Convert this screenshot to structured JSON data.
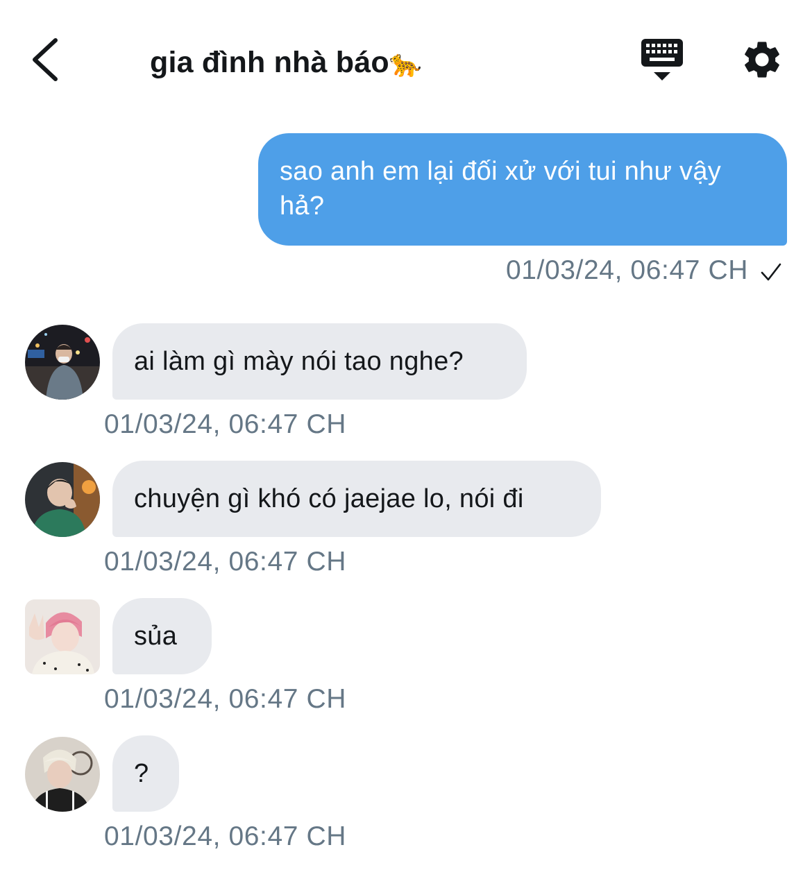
{
  "header": {
    "title": "gia đình nhà báo",
    "title_emoji": "🐆",
    "back_icon": "chevron-left-icon",
    "keyboard_icon": "keyboard-hide-icon",
    "settings_icon": "gear-icon"
  },
  "colors": {
    "outgoing_bubble": "#4e9fe8",
    "incoming_bubble": "#e8eaee",
    "timestamp": "#657786"
  },
  "messages": [
    {
      "direction": "outgoing",
      "text": "sao anh em lại đối xử với tui như vậy hả?",
      "timestamp": "01/03/24, 06:47 CH",
      "status_icon": "checkmark-icon"
    },
    {
      "direction": "incoming",
      "text": "ai làm gì mày nói tao nghe?",
      "timestamp": "01/03/24, 06:47 CH"
    },
    {
      "direction": "incoming",
      "text": "chuyện gì khó có jaejae lo, nói đi",
      "timestamp": "01/03/24, 06:47 CH"
    },
    {
      "direction": "incoming",
      "text": "sủa",
      "timestamp": "01/03/24, 06:47 CH"
    },
    {
      "direction": "incoming",
      "text": "?",
      "timestamp": "01/03/24, 06:47 CH"
    }
  ]
}
